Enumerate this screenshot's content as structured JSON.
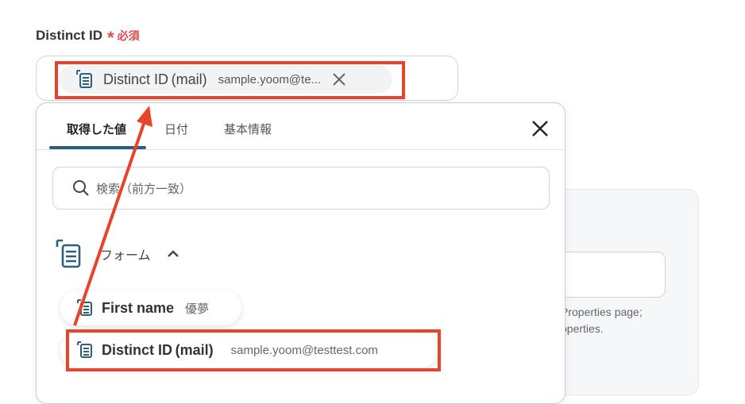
{
  "field": {
    "label": "Distinct ID",
    "required_mark": "*",
    "required_text": "必須"
  },
  "selected_chip": {
    "icon": "form-icon",
    "name": "Distinct ID (mail)",
    "value": "sample.yoom@te...",
    "remove_icon": "close-icon"
  },
  "dropdown": {
    "tabs": [
      {
        "label": "取得した値",
        "active": true
      },
      {
        "label": "日付",
        "active": false
      },
      {
        "label": "基本情報",
        "active": false
      }
    ],
    "search": {
      "placeholder": "検索（前方一致）"
    },
    "group": {
      "label": "フォーム",
      "icon": "form-icon",
      "expanded": true
    },
    "items": [
      {
        "name": "First name",
        "value": "優夢"
      },
      {
        "name": "Distinct ID (mail)",
        "value": "sample.yoom@testtest.com"
      }
    ]
  },
  "background_panel": {
    "help_line_1": "Properties page;",
    "help_line_2": "operties."
  },
  "colors": {
    "highlight": "#e8442c",
    "required": "#e5484d",
    "tab_underline": "#2c5f7a"
  }
}
